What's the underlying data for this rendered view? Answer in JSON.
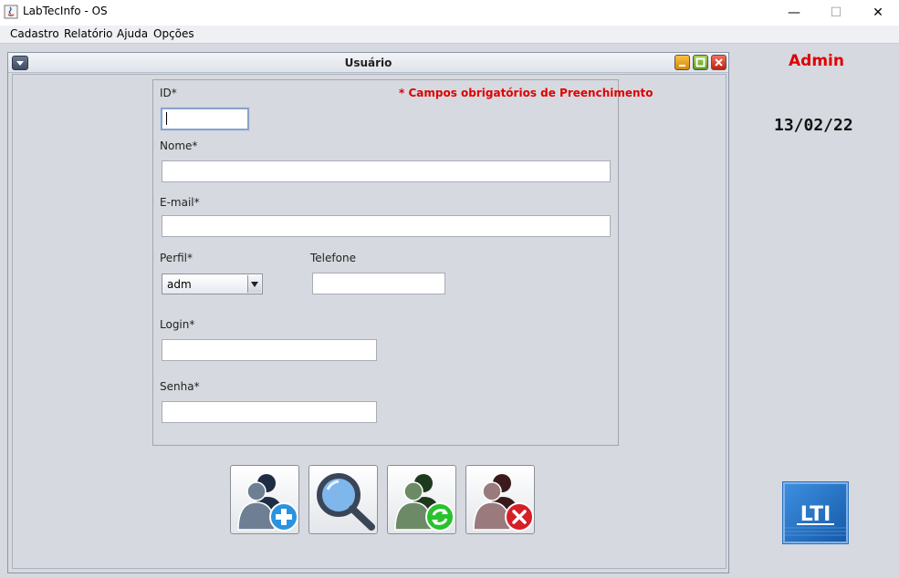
{
  "window": {
    "title": "LabTecInfo - OS",
    "controls": {
      "minimize": "—",
      "maximize": "☐",
      "close": "✕"
    }
  },
  "menu": {
    "items": [
      "Cadastro",
      "Relatório",
      "Ajuda",
      "Opções"
    ]
  },
  "internal_frame": {
    "title": "Usuário"
  },
  "form": {
    "required_note": "* Campos obrigatórios de Preenchimento",
    "id_label": "ID*",
    "id_value": "",
    "name_label": "Nome*",
    "name_value": "",
    "email_label": "E-mail*",
    "email_value": "",
    "perfil_label": "Perfil*",
    "perfil_value": "adm",
    "phone_label": "Telefone",
    "phone_value": "",
    "login_label": "Login*",
    "login_value": "",
    "password_label": "Senha*",
    "password_value": ""
  },
  "actions": {
    "icons": [
      "add-user-icon",
      "search-icon",
      "update-user-icon",
      "delete-user-icon"
    ]
  },
  "sidebar": {
    "user": "Admin",
    "date": "13/02/22",
    "logo_text": "LTI"
  },
  "colors": {
    "required": "#e00000",
    "frame_bg": "#d6d9df"
  }
}
